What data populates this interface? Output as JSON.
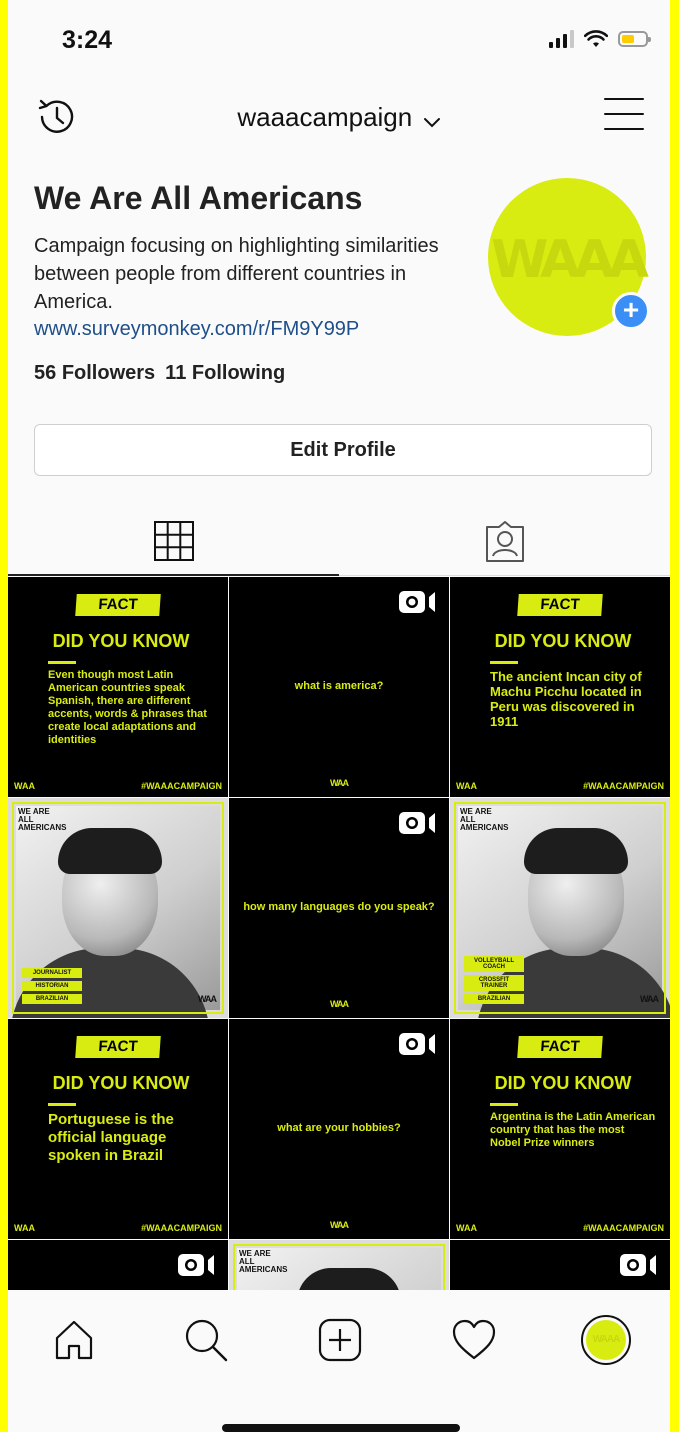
{
  "status_bar": {
    "time": "3:24"
  },
  "header": {
    "username": "waaacampaign"
  },
  "profile": {
    "name": "We Are All Americans",
    "bio": "Campaign focusing on highlighting similarities between people from different countries in America.",
    "link": "www.surveymonkey.com/r/FM9Y99P",
    "followers_count": "56",
    "followers_label": "Followers",
    "following_count": "11",
    "following_label": "Following",
    "avatar_text": "WAAA",
    "edit_profile_label": "Edit Profile"
  },
  "colors": {
    "accent": "#d9ec12",
    "link": "#1f4f8a",
    "add_button": "#3a8ef6"
  },
  "posts": [
    {
      "type": "fact",
      "badge": "FACT",
      "heading": "DID YOU KNOW",
      "body": "Even though most Latin American countries speak Spanish, there are different accents, words & phrases that create local adaptations and identities",
      "footer_left": "WAA",
      "footer_right": "#WAAACAMPAIGN"
    },
    {
      "type": "video",
      "question": "what is america?",
      "footer": "WAA"
    },
    {
      "type": "fact",
      "badge": "FACT",
      "heading": "DID YOU KNOW",
      "body": "The ancient Incan city of Machu Picchu located in Peru was discovered in 1911",
      "footer_left": "WAA",
      "footer_right": "#WAAACAMPAIGN"
    },
    {
      "type": "portrait",
      "header": "WE ARE ALL AMERICANS",
      "tags": [
        "JOURNALIST",
        "HISTORIAN",
        "BRAZILIAN"
      ],
      "corner": "WAA"
    },
    {
      "type": "video",
      "question": "how many languages do you speak?",
      "footer": "WAA"
    },
    {
      "type": "portrait",
      "header": "WE ARE ALL AMERICANS",
      "tags": [
        "VOLLEYBALL COACH",
        "CROSSFIT TRAINER",
        "BRAZILIAN"
      ],
      "corner": "WAA"
    },
    {
      "type": "fact",
      "badge": "FACT",
      "heading": "DID YOU KNOW",
      "body": "Portuguese is the official language spoken in Brazil",
      "footer_left": "WAA",
      "footer_right": "#WAAACAMPAIGN"
    },
    {
      "type": "video",
      "question": "what are your hobbies?",
      "footer": "WAA"
    },
    {
      "type": "fact",
      "badge": "FACT",
      "heading": "DID YOU KNOW",
      "body": "Argentina is the Latin American country that has the most Nobel Prize winners",
      "footer_left": "WAA",
      "footer_right": "#WAAACAMPAIGN"
    },
    {
      "type": "video-partial"
    },
    {
      "type": "portrait-partial",
      "header": "WE ARE ALL AMERICANS"
    },
    {
      "type": "video-partial"
    }
  ],
  "nav": {
    "items": [
      "home-icon",
      "search-icon",
      "new-post-icon",
      "activity-heart-icon",
      "profile-avatar"
    ]
  }
}
